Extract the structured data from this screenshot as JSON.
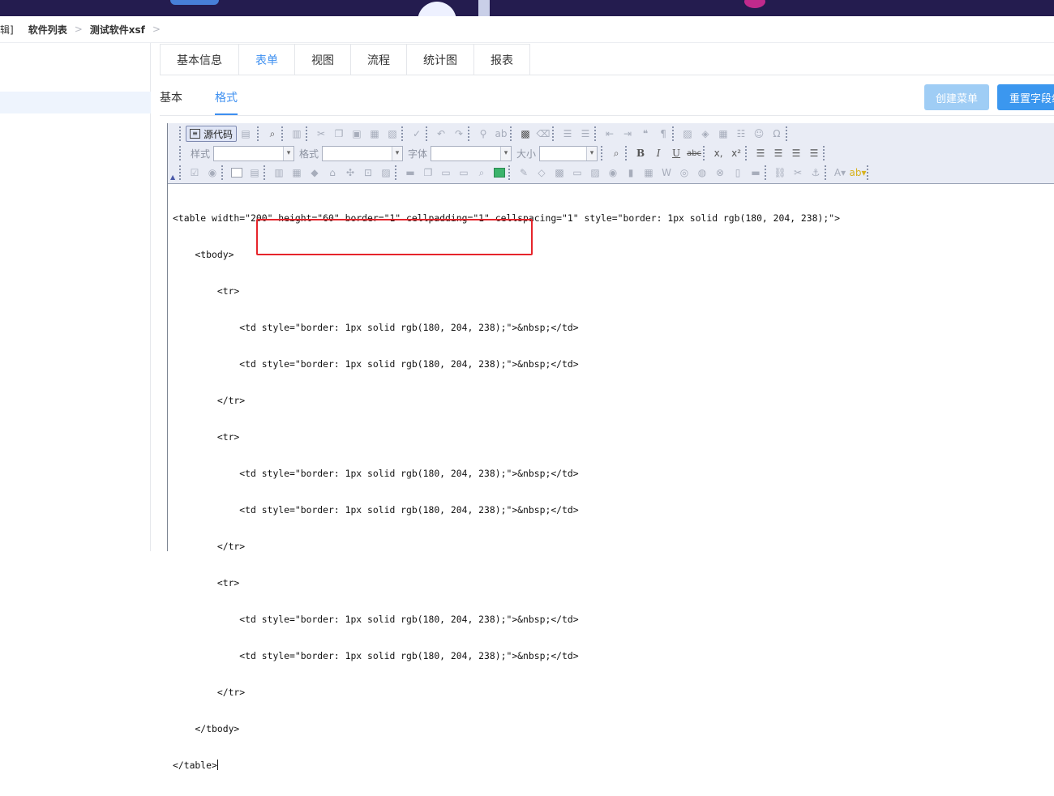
{
  "breadcrumb": {
    "partial_left": "辑]",
    "items": [
      "软件列表",
      "测试软件xsf"
    ],
    "separator": ">"
  },
  "tabs": [
    {
      "label": "基本信息",
      "active": false
    },
    {
      "label": "表单",
      "active": true
    },
    {
      "label": "视图",
      "active": false
    },
    {
      "label": "流程",
      "active": false
    },
    {
      "label": "统计图",
      "active": false
    },
    {
      "label": "报表",
      "active": false
    }
  ],
  "subtabs": [
    {
      "label": "基本",
      "active": false
    },
    {
      "label": "格式",
      "active": true
    }
  ],
  "buttons": {
    "create_menu": "创建菜单",
    "reset_fields": "重置字段组"
  },
  "editor": {
    "source_label": "源代码",
    "combo_labels": {
      "style": "样式",
      "format": "格式",
      "font": "字体",
      "size": "大小"
    },
    "toolbar_glyphs": {
      "bold": "B",
      "italic": "I",
      "underline": "U",
      "strike": "abc",
      "subscript": "x,",
      "superscript": "x²",
      "omega": "Ω",
      "quote": "❝",
      "collapse": "▲"
    },
    "code_lines": [
      "<table width=\"200\" height=\"60\" border=\"1\" cellpadding=\"1\" cellspacing=\"1\" style=\"border: 1px solid rgb(180, 204, 238);\">",
      "    <tbody>",
      "        <tr>",
      "            <td style=\"border: 1px solid rgb(180, 204, 238);\">&nbsp;</td>",
      "            <td style=\"border: 1px solid rgb(180, 204, 238);\">&nbsp;</td>",
      "        </tr>",
      "        <tr>",
      "            <td style=\"border: 1px solid rgb(180, 204, 238);\">&nbsp;</td>",
      "            <td style=\"border: 1px solid rgb(180, 204, 238);\">&nbsp;</td>",
      "        </tr>",
      "        <tr>",
      "            <td style=\"border: 1px solid rgb(180, 204, 238);\">&nbsp;</td>",
      "            <td style=\"border: 1px solid rgb(180, 204, 238);\">&nbsp;</td>",
      "        </tr>",
      "    </tbody>",
      "</table>"
    ]
  },
  "colors": {
    "accent": "#3d8ff0",
    "topbar": "#241c4f",
    "highlight": "#e6242b",
    "create_button": "#9fcdf5",
    "reset_button": "#3b97ef"
  }
}
